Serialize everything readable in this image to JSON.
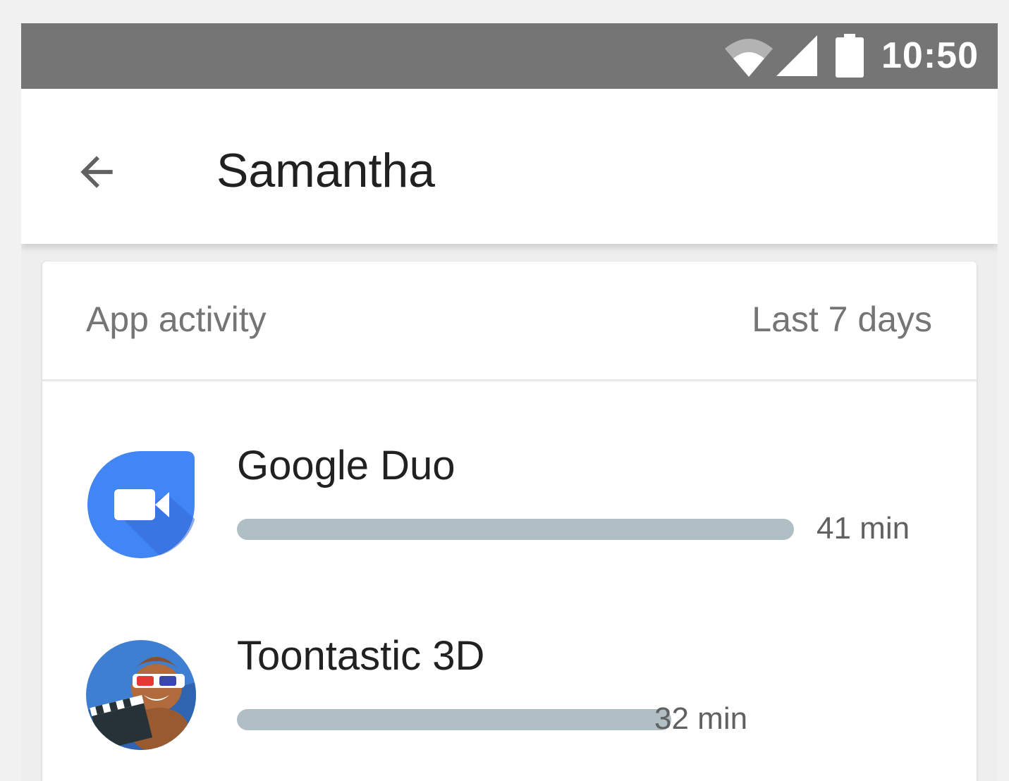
{
  "status_bar": {
    "time": "10:50",
    "icons": [
      "wifi-icon",
      "cell-signal-icon",
      "battery-icon"
    ],
    "background": "#757575"
  },
  "app_bar": {
    "back_icon": "arrow-back-icon",
    "title": "Samantha"
  },
  "card": {
    "title": "App activity",
    "period": "Last 7 days",
    "apps": [
      {
        "name": "Google Duo",
        "icon": "google-duo-icon",
        "usage": "41 min",
        "usage_fraction_of_max": 1.0,
        "bar_color": "#b0bec5"
      },
      {
        "name": "Toontastic 3D",
        "icon": "toontastic-3d-icon",
        "usage": "32 min",
        "usage_fraction_of_max": 0.78,
        "bar_color": "#b0bec5"
      }
    ]
  },
  "colors": {
    "primary_text": "#212121",
    "secondary_text": "#757575",
    "duo_blue": "#4285f4"
  }
}
